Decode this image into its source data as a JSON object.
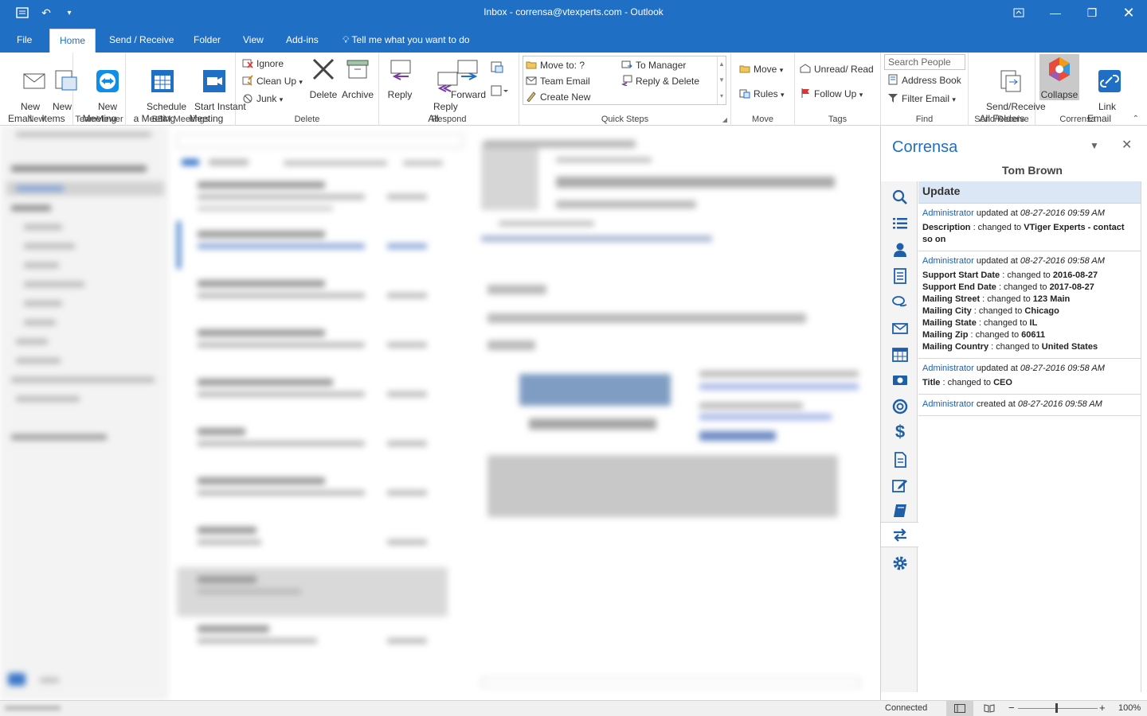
{
  "window": {
    "title": "Inbox - corrensa@vtexperts.com - Outlook"
  },
  "tabs": [
    {
      "label": "File"
    },
    {
      "label": "Home"
    },
    {
      "label": "Send / Receive"
    },
    {
      "label": "Folder"
    },
    {
      "label": "View"
    },
    {
      "label": "Add-ins"
    },
    {
      "label": "Tell me what you want to do"
    }
  ],
  "ribbon": {
    "new": {
      "label": "New",
      "new_email": "New\nEmail",
      "new_items": "New\nItems"
    },
    "teamviewer": {
      "label": "TeamViewer",
      "new_meeting": "New\nMeeting"
    },
    "bbm": {
      "label": "BBM Meetings",
      "schedule": "Schedule\na Meeting",
      "instant": "Start Instant\nMeeting"
    },
    "delete": {
      "label": "Delete",
      "ignore": "Ignore",
      "clean_up": "Clean Up",
      "junk": "Junk",
      "delete": "Delete",
      "archive": "Archive"
    },
    "respond": {
      "label": "Respond",
      "reply": "Reply",
      "reply_all": "Reply\nAll",
      "forward": "Forward"
    },
    "quick_steps": {
      "label": "Quick Steps",
      "move_to": "Move to: ?",
      "team_email": "Team Email",
      "create_new": "Create New",
      "to_manager": "To Manager",
      "reply_delete": "Reply & Delete"
    },
    "move": {
      "label": "Move",
      "move": "Move",
      "rules": "Rules"
    },
    "tags": {
      "label": "Tags",
      "unread_read": "Unread/ Read",
      "follow_up": "Follow Up"
    },
    "find": {
      "label": "Find",
      "search_people": "Search People",
      "address_book": "Address Book",
      "filter_email": "Filter Email"
    },
    "send_receive": {
      "label": "Send/Receive",
      "all_folders": "Send/Receive\nAll Folders"
    },
    "corrensa": {
      "label": "Corrensa",
      "collapse": "Collapse",
      "link_email": "Link\nEmail"
    }
  },
  "pane": {
    "title": "Corrensa",
    "contact": "Tom Brown",
    "feed_header": "Update",
    "entries": [
      {
        "actor": "Administrator",
        "verb": " updated at ",
        "when": "08-27-2016 09:59 AM",
        "changes": [
          {
            "field": "Description",
            "sep": " : changed to ",
            "value": "VTiger Experts - contact so on"
          }
        ]
      },
      {
        "actor": "Administrator",
        "verb": " updated at ",
        "when": "08-27-2016 09:58 AM",
        "changes": [
          {
            "field": "Support Start Date",
            "sep": " : changed to ",
            "value": "2016-08-27"
          },
          {
            "field": "Support End Date",
            "sep": " : changed to ",
            "value": "2017-08-27"
          },
          {
            "field": "Mailing Street",
            "sep": " : changed to ",
            "value": "123 Main"
          },
          {
            "field": "Mailing City",
            "sep": " : changed to ",
            "value": "Chicago"
          },
          {
            "field": "Mailing State",
            "sep": " : changed to ",
            "value": "IL"
          },
          {
            "field": "Mailing Zip",
            "sep": " : changed to ",
            "value": "60611"
          },
          {
            "field": "Mailing Country",
            "sep": " : changed to ",
            "value": "United States"
          }
        ]
      },
      {
        "actor": "Administrator",
        "verb": " updated at ",
        "when": "08-27-2016 09:58 AM",
        "changes": [
          {
            "field": "Title",
            "sep": " : changed to ",
            "value": "CEO"
          }
        ]
      },
      {
        "actor": "Administrator",
        "verb": " created at ",
        "when": "08-27-2016 09:58 AM",
        "changes": []
      }
    ]
  },
  "status": {
    "connected": "Connected",
    "zoom": "100%"
  },
  "colors": {
    "accent": "#1f6fc5",
    "link": "#1f5fb4",
    "header": "#dbe7f5"
  }
}
